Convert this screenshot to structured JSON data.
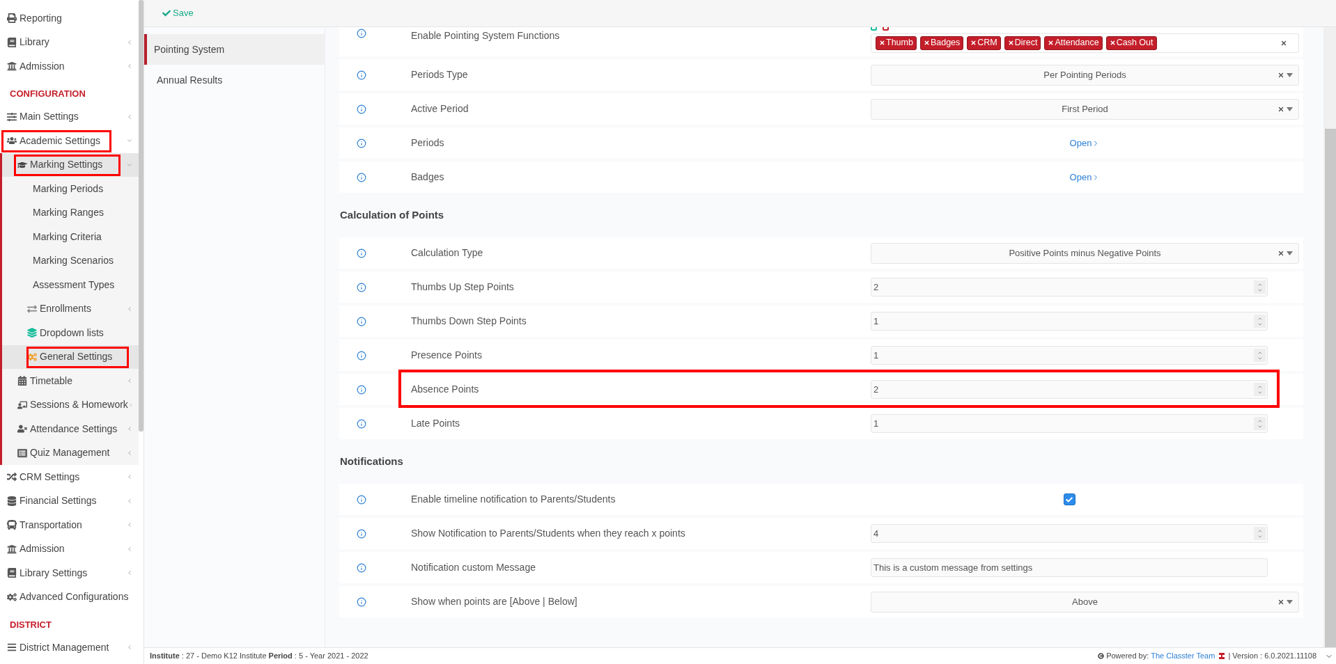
{
  "sidebar": {
    "groups": [
      {
        "items": [
          {
            "label": "Reporting"
          },
          {
            "label": "Library",
            "expanded": false
          },
          {
            "label": "Admission",
            "expanded": false
          }
        ]
      },
      {
        "heading": "CONFIGURATION",
        "items": [
          {
            "label": "Main Settings",
            "expanded": false
          },
          {
            "label": "Academic Settings",
            "expanded": true,
            "highlighted": true,
            "children": [
              {
                "label": "Marking Settings",
                "expanded": true,
                "selected": true,
                "highlighted": true,
                "children": [
                  {
                    "label": "Marking Periods",
                    "selected": false
                  },
                  {
                    "label": "Marking Ranges",
                    "selected": false
                  },
                  {
                    "label": "Marking Criteria",
                    "selected": false
                  },
                  {
                    "label": "Marking Scenarios",
                    "selected": false
                  },
                  {
                    "label": "Assessment Types",
                    "selected": false
                  },
                  {
                    "label": "Enrollments",
                    "expanded": false,
                    "selected": false
                  },
                  {
                    "label": "Dropdown lists",
                    "selected": false
                  },
                  {
                    "label": "General Settings",
                    "selected": true,
                    "highlighted": true
                  }
                ]
              },
              {
                "label": "Timetable",
                "expanded": false,
                "selected": false
              },
              {
                "label": "Sessions & Homework",
                "expanded": false,
                "selected": false
              },
              {
                "label": "Attendance Settings",
                "expanded": false,
                "selected": false
              },
              {
                "label": "Quiz Management",
                "expanded": false,
                "selected": false
              }
            ]
          },
          {
            "label": "CRM Settings",
            "expanded": false
          },
          {
            "label": "Financial Settings",
            "expanded": false
          },
          {
            "label": "Transportation",
            "expanded": false
          },
          {
            "label": "Admission",
            "expanded": false
          },
          {
            "label": "Library Settings",
            "expanded": false
          },
          {
            "label": "Advanced Configurations"
          }
        ]
      },
      {
        "heading": "DISTRICT",
        "items": [
          {
            "label": "District Management",
            "expanded": false
          }
        ]
      }
    ]
  },
  "toolbar": {
    "save": "Save"
  },
  "tabs": [
    {
      "label": "Pointing System",
      "selected": true
    },
    {
      "label": "Annual Results",
      "selected": false
    }
  ],
  "sections": [
    {
      "rows": [
        {
          "kind": "tags",
          "label": "Enable Pointing System Functions",
          "tags": [
            "Thumb",
            "Badges",
            "CRM",
            "Direct",
            "Attendance",
            "Cash Out"
          ]
        },
        {
          "kind": "select",
          "label": "Periods Type",
          "value": "Per Pointing Periods"
        },
        {
          "kind": "select",
          "label": "Active Period",
          "value": "First Period"
        },
        {
          "kind": "link",
          "label": "Periods",
          "value": "Open"
        },
        {
          "kind": "link",
          "label": "Badges",
          "value": "Open"
        }
      ]
    },
    {
      "heading": "Calculation of Points",
      "rows": [
        {
          "kind": "select",
          "label": "Calculation Type",
          "value": "Positive Points minus Negative Points"
        },
        {
          "kind": "number",
          "label": "Thumbs Up Step Points",
          "value": "2"
        },
        {
          "kind": "number",
          "label": "Thumbs Down Step Points",
          "value": "1"
        },
        {
          "kind": "number",
          "label": "Presence Points",
          "value": "1"
        },
        {
          "kind": "number",
          "label": "Absence Points",
          "value": "2",
          "highlighted": true
        },
        {
          "kind": "number",
          "label": "Late Points",
          "value": "1"
        }
      ]
    },
    {
      "heading": "Notifications",
      "rows": [
        {
          "kind": "checkbox",
          "label": "Enable timeline notification to Parents/Students",
          "checked": true
        },
        {
          "kind": "number",
          "label": "Show Notification to Parents/Students when they reach x points",
          "value": "4"
        },
        {
          "kind": "text",
          "label": "Notification custom Message",
          "value": "This is a custom message from settings"
        },
        {
          "kind": "select",
          "label": "Show when points are [Above | Below]",
          "value": "Above"
        }
      ]
    }
  ],
  "footer": {
    "info": "**Institute** : 27 - Demo K12 Institute **Period** : 5 - Year 2021 - 2022",
    "powered": "Powered by:",
    "team": "The Classter Team",
    "version": "| Version : 6.0.2021.11108"
  }
}
